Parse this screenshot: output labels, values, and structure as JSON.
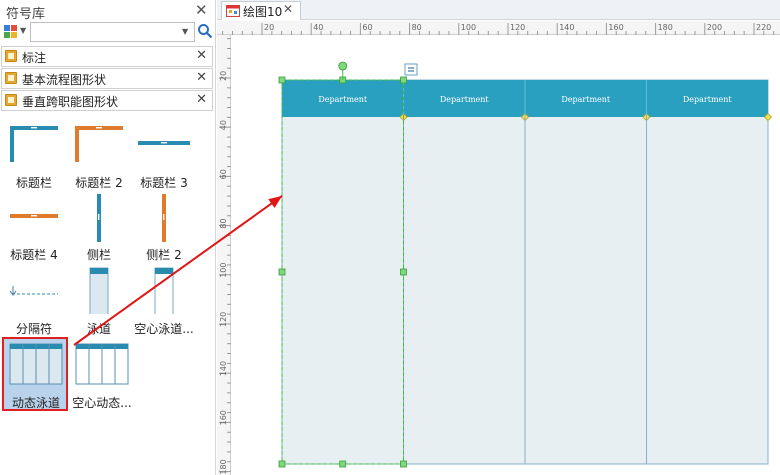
{
  "panel": {
    "title": "符号库",
    "search_placeholder": "",
    "libraries": [
      {
        "label": "标注"
      },
      {
        "label": "基本流程图形状"
      },
      {
        "label": "垂直跨职能图形状"
      }
    ],
    "shapes": [
      {
        "label": "标题栏"
      },
      {
        "label": "标题栏 2"
      },
      {
        "label": "标题栏 3"
      },
      {
        "label": "标题栏 4"
      },
      {
        "label": "侧栏"
      },
      {
        "label": "侧栏 2"
      },
      {
        "label": "分隔符"
      },
      {
        "label": "泳道"
      },
      {
        "label": "空心泳道..."
      },
      {
        "label": "动态泳道"
      },
      {
        "label": "空心动态..."
      }
    ]
  },
  "tabs": [
    {
      "label": "绘图10"
    }
  ],
  "ruler": {
    "top_ticks": [
      "20",
      "40",
      "60",
      "80",
      "100",
      "120",
      "140",
      "160",
      "180",
      "200",
      "220"
    ],
    "left_ticks": [
      "20",
      "40",
      "60",
      "80",
      "100",
      "120",
      "140",
      "160",
      "180"
    ]
  },
  "diagram": {
    "lanes": [
      {
        "header": "Department"
      },
      {
        "header": "Department"
      },
      {
        "header": "Department"
      },
      {
        "header": "Department"
      }
    ]
  },
  "colors": {
    "header_fill": "#2aa0c0",
    "lane_fill": "#e8eff3",
    "lane_border": "#86b0c6",
    "selection": "#3cc03c",
    "handle": "#7ed87e",
    "diamond": "#f1e05a",
    "arrow": "#e01515"
  }
}
